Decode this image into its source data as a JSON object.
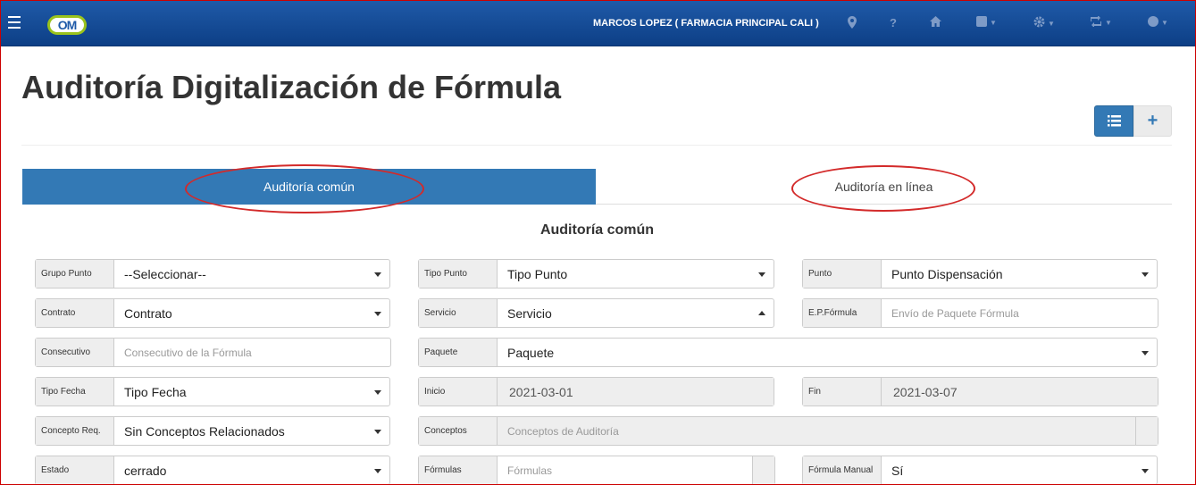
{
  "header": {
    "logo_text": "OM",
    "user_label": "MARCOS LOPEZ ( FARMACIA PRINCIPAL CALI )",
    "icons": [
      "map-marker-icon",
      "question-icon",
      "home-icon",
      "square-icon",
      "gear-icon",
      "retweet-icon",
      "user-circle-icon"
    ]
  },
  "page": {
    "title": "Auditoría Digitalización de Fórmula"
  },
  "actions": {
    "add_label": "+"
  },
  "tabs": {
    "common": "Auditoría común",
    "online": "Auditoría en línea"
  },
  "section": {
    "title": "Auditoría común"
  },
  "fields": {
    "grupo_punto": {
      "label": "Grupo Punto",
      "value": "--Seleccionar--"
    },
    "tipo_punto": {
      "label": "Tipo Punto",
      "value": "Tipo Punto"
    },
    "punto": {
      "label": "Punto",
      "value": "Punto Dispensación"
    },
    "contrato": {
      "label": "Contrato",
      "value": "Contrato"
    },
    "servicio": {
      "label": "Servicio",
      "value": "Servicio"
    },
    "ep_formula": {
      "label": "E.P.Fórmula",
      "placeholder": "Envío de Paquete Fórmula"
    },
    "consecutivo": {
      "label": "Consecutivo",
      "placeholder": "Consecutivo de la Fórmula"
    },
    "paquete": {
      "label": "Paquete",
      "value": "Paquete"
    },
    "tipo_fecha": {
      "label": "Tipo Fecha",
      "value": "Tipo Fecha"
    },
    "inicio": {
      "label": "Inicio",
      "value": "2021-03-01"
    },
    "fin": {
      "label": "Fin",
      "value": "2021-03-07"
    },
    "concepto_req": {
      "label": "Concepto Req.",
      "value": "Sin Conceptos Relacionados"
    },
    "conceptos": {
      "label": "Conceptos",
      "placeholder": "Conceptos de Auditoría"
    },
    "estado": {
      "label": "Estado",
      "value": "cerrado"
    },
    "formulas": {
      "label": "Fórmulas",
      "placeholder": "Fórmulas"
    },
    "formula_manual": {
      "label": "Fórmula Manual",
      "value": "Sí"
    }
  },
  "colors": {
    "primary": "#3379b5",
    "header_bg": "#0d3f86",
    "annotation": "#d32a2a"
  }
}
